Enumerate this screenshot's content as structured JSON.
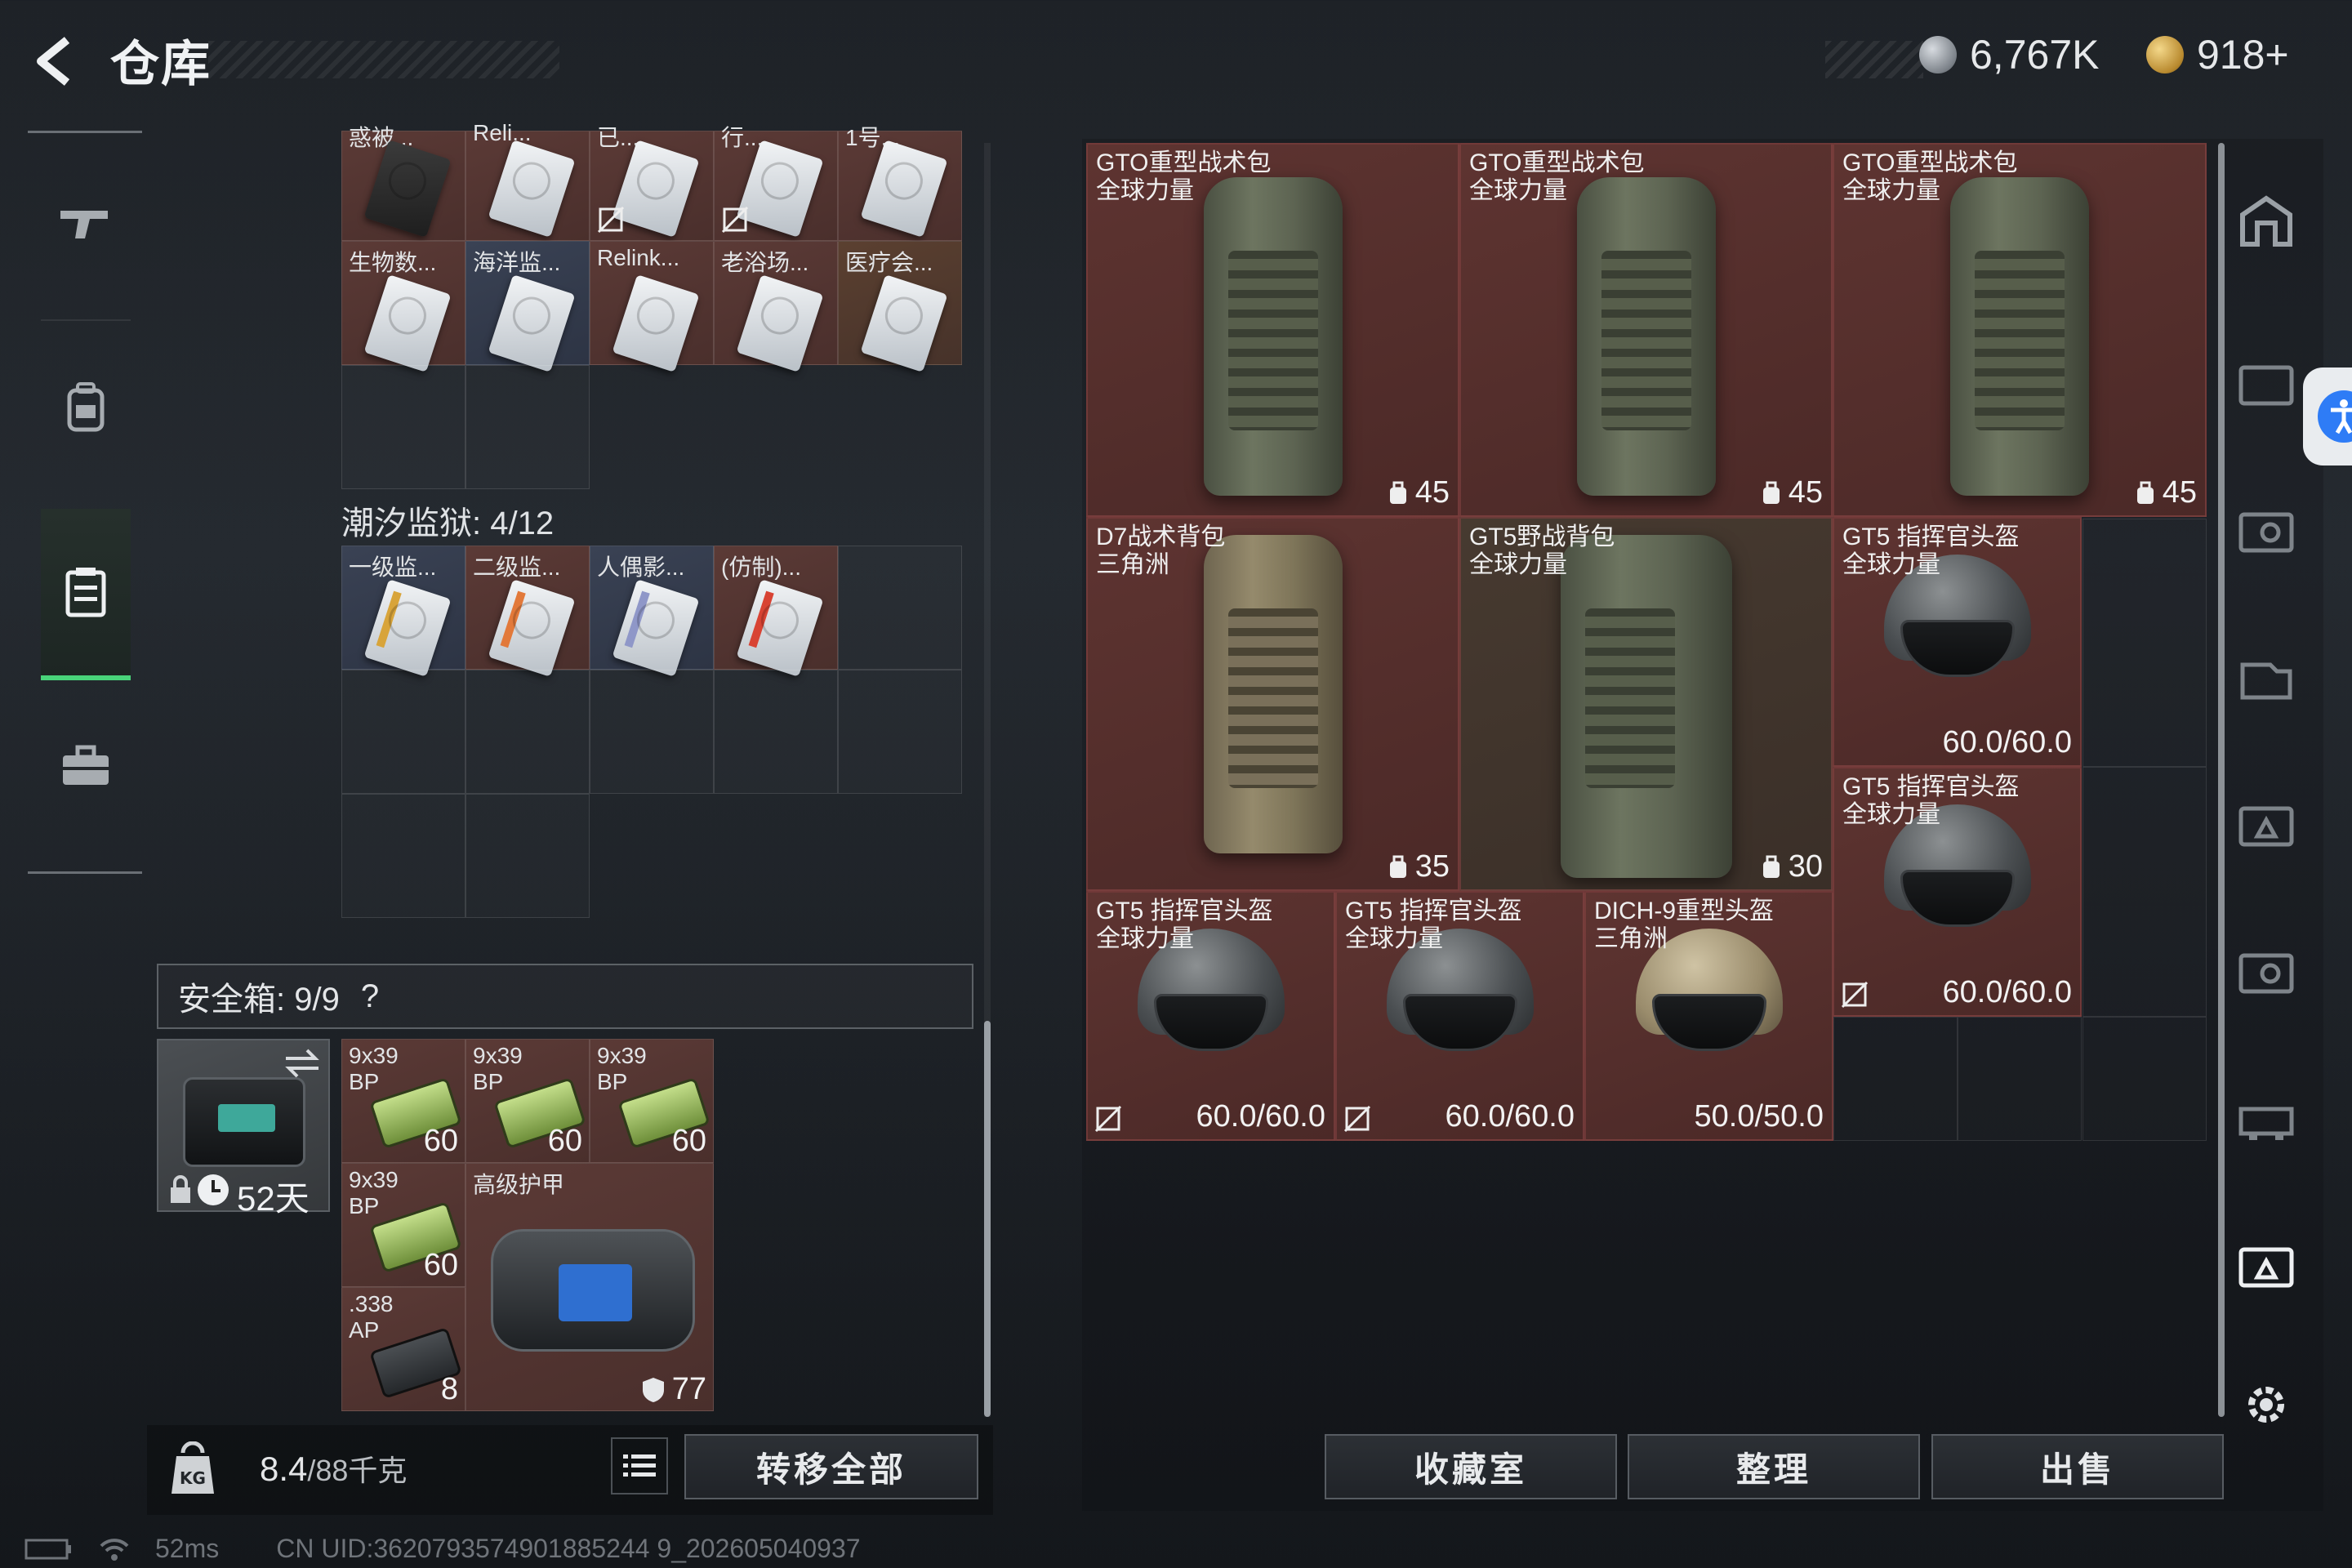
{
  "header": {
    "title": "仓库",
    "currency_silver": "6,767K",
    "currency_gold": "918+"
  },
  "top_grid": {
    "row1_labels": [
      "惑被...",
      "Reli...",
      "已...",
      "行...",
      "1号..."
    ],
    "row2_labels": [
      "生物数...",
      "海洋监...",
      "Relink...",
      "老浴场...",
      "医疗会..."
    ]
  },
  "tide_prison": {
    "label": "潮汐监狱: 4/12",
    "items": [
      "一级监...",
      "二级监...",
      "人偶影...",
      "(仿制)..."
    ]
  },
  "safe_box": {
    "label": "安全箱: 9/9",
    "help": "?",
    "timer": "52天",
    "items": [
      {
        "label": "9x39\nBP",
        "qty": "60"
      },
      {
        "label": "9x39\nBP",
        "qty": "60"
      },
      {
        "label": "9x39\nBP",
        "qty": "60"
      },
      {
        "label": "9x39\nBP",
        "qty": "60"
      },
      {
        "label": ".338\nAP",
        "qty": "8"
      }
    ],
    "armor": {
      "label": "高级护甲",
      "durability": "77"
    }
  },
  "footer_left": {
    "weight_value": "8.4",
    "weight_max": "/88千克",
    "transfer_all": "转移全部"
  },
  "storage_items": [
    {
      "name": "GTO重型战术包\n全球力量",
      "capacity": "45"
    },
    {
      "name": "GTO重型战术包\n全球力量",
      "capacity": "45"
    },
    {
      "name": "GTO重型战术包\n全球力量",
      "capacity": "45"
    },
    {
      "name": "D7战术背包\n三角洲",
      "capacity": "35"
    },
    {
      "name": "GT5野战背包\n全球力量",
      "capacity": "30"
    },
    {
      "name": "GT5 指挥官头盔\n全球力量",
      "durability": "60.0/60.0"
    },
    {
      "name": "GT5 指挥官头盔\n全球力量",
      "durability": "60.0/60.0"
    },
    {
      "name": "GT5 指挥官头盔\n全球力量",
      "durability": "60.0/60.0"
    },
    {
      "name": "GT5 指挥官头盔\n全球力量",
      "durability": "60.0/60.0"
    },
    {
      "name": "DICH-9重型头盔\n三角洲",
      "durability": "50.0/50.0"
    }
  ],
  "footer_right": {
    "collection": "收藏室",
    "organize": "整理",
    "sell": "出售"
  },
  "status": {
    "ping": "52ms",
    "uid": "CN UID:3620793574901885244 9_202605040937"
  },
  "colors": {
    "accent_green": "#49d47a",
    "item_red": "#5e3431",
    "accessibility_blue": "#2e7cf6"
  }
}
